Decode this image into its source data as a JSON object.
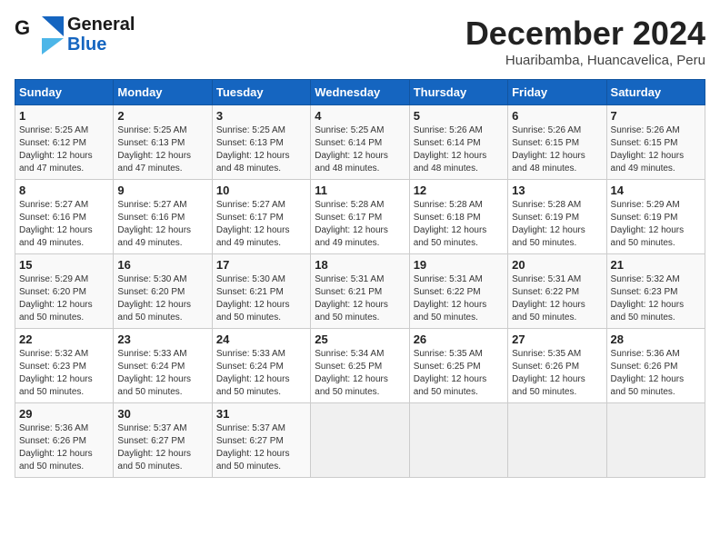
{
  "header": {
    "logo_line1": "General",
    "logo_line2": "Blue",
    "month": "December 2024",
    "location": "Huaribamba, Huancavelica, Peru"
  },
  "weekdays": [
    "Sunday",
    "Monday",
    "Tuesday",
    "Wednesday",
    "Thursday",
    "Friday",
    "Saturday"
  ],
  "weeks": [
    [
      {
        "day": "1",
        "info": "Sunrise: 5:25 AM\nSunset: 6:12 PM\nDaylight: 12 hours\nand 47 minutes."
      },
      {
        "day": "2",
        "info": "Sunrise: 5:25 AM\nSunset: 6:13 PM\nDaylight: 12 hours\nand 47 minutes."
      },
      {
        "day": "3",
        "info": "Sunrise: 5:25 AM\nSunset: 6:13 PM\nDaylight: 12 hours\nand 48 minutes."
      },
      {
        "day": "4",
        "info": "Sunrise: 5:25 AM\nSunset: 6:14 PM\nDaylight: 12 hours\nand 48 minutes."
      },
      {
        "day": "5",
        "info": "Sunrise: 5:26 AM\nSunset: 6:14 PM\nDaylight: 12 hours\nand 48 minutes."
      },
      {
        "day": "6",
        "info": "Sunrise: 5:26 AM\nSunset: 6:15 PM\nDaylight: 12 hours\nand 48 minutes."
      },
      {
        "day": "7",
        "info": "Sunrise: 5:26 AM\nSunset: 6:15 PM\nDaylight: 12 hours\nand 49 minutes."
      }
    ],
    [
      {
        "day": "8",
        "info": "Sunrise: 5:27 AM\nSunset: 6:16 PM\nDaylight: 12 hours\nand 49 minutes."
      },
      {
        "day": "9",
        "info": "Sunrise: 5:27 AM\nSunset: 6:16 PM\nDaylight: 12 hours\nand 49 minutes."
      },
      {
        "day": "10",
        "info": "Sunrise: 5:27 AM\nSunset: 6:17 PM\nDaylight: 12 hours\nand 49 minutes."
      },
      {
        "day": "11",
        "info": "Sunrise: 5:28 AM\nSunset: 6:17 PM\nDaylight: 12 hours\nand 49 minutes."
      },
      {
        "day": "12",
        "info": "Sunrise: 5:28 AM\nSunset: 6:18 PM\nDaylight: 12 hours\nand 50 minutes."
      },
      {
        "day": "13",
        "info": "Sunrise: 5:28 AM\nSunset: 6:19 PM\nDaylight: 12 hours\nand 50 minutes."
      },
      {
        "day": "14",
        "info": "Sunrise: 5:29 AM\nSunset: 6:19 PM\nDaylight: 12 hours\nand 50 minutes."
      }
    ],
    [
      {
        "day": "15",
        "info": "Sunrise: 5:29 AM\nSunset: 6:20 PM\nDaylight: 12 hours\nand 50 minutes."
      },
      {
        "day": "16",
        "info": "Sunrise: 5:30 AM\nSunset: 6:20 PM\nDaylight: 12 hours\nand 50 minutes."
      },
      {
        "day": "17",
        "info": "Sunrise: 5:30 AM\nSunset: 6:21 PM\nDaylight: 12 hours\nand 50 minutes."
      },
      {
        "day": "18",
        "info": "Sunrise: 5:31 AM\nSunset: 6:21 PM\nDaylight: 12 hours\nand 50 minutes."
      },
      {
        "day": "19",
        "info": "Sunrise: 5:31 AM\nSunset: 6:22 PM\nDaylight: 12 hours\nand 50 minutes."
      },
      {
        "day": "20",
        "info": "Sunrise: 5:31 AM\nSunset: 6:22 PM\nDaylight: 12 hours\nand 50 minutes."
      },
      {
        "day": "21",
        "info": "Sunrise: 5:32 AM\nSunset: 6:23 PM\nDaylight: 12 hours\nand 50 minutes."
      }
    ],
    [
      {
        "day": "22",
        "info": "Sunrise: 5:32 AM\nSunset: 6:23 PM\nDaylight: 12 hours\nand 50 minutes."
      },
      {
        "day": "23",
        "info": "Sunrise: 5:33 AM\nSunset: 6:24 PM\nDaylight: 12 hours\nand 50 minutes."
      },
      {
        "day": "24",
        "info": "Sunrise: 5:33 AM\nSunset: 6:24 PM\nDaylight: 12 hours\nand 50 minutes."
      },
      {
        "day": "25",
        "info": "Sunrise: 5:34 AM\nSunset: 6:25 PM\nDaylight: 12 hours\nand 50 minutes."
      },
      {
        "day": "26",
        "info": "Sunrise: 5:35 AM\nSunset: 6:25 PM\nDaylight: 12 hours\nand 50 minutes."
      },
      {
        "day": "27",
        "info": "Sunrise: 5:35 AM\nSunset: 6:26 PM\nDaylight: 12 hours\nand 50 minutes."
      },
      {
        "day": "28",
        "info": "Sunrise: 5:36 AM\nSunset: 6:26 PM\nDaylight: 12 hours\nand 50 minutes."
      }
    ],
    [
      {
        "day": "29",
        "info": "Sunrise: 5:36 AM\nSunset: 6:26 PM\nDaylight: 12 hours\nand 50 minutes."
      },
      {
        "day": "30",
        "info": "Sunrise: 5:37 AM\nSunset: 6:27 PM\nDaylight: 12 hours\nand 50 minutes."
      },
      {
        "day": "31",
        "info": "Sunrise: 5:37 AM\nSunset: 6:27 PM\nDaylight: 12 hours\nand 50 minutes."
      },
      null,
      null,
      null,
      null
    ]
  ]
}
